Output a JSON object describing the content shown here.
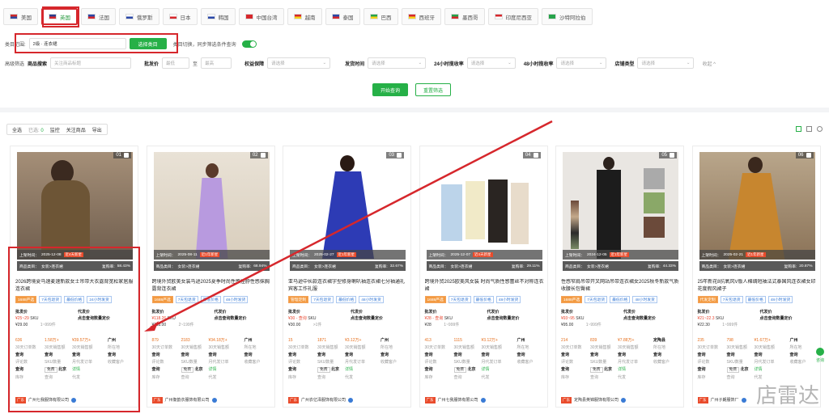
{
  "tabs": [
    {
      "label": "美国",
      "c1": "#cf2b2b",
      "c2": "#2f4aa0"
    },
    {
      "label": "英国",
      "c1": "#2c3f8f",
      "c2": "#d6272c"
    },
    {
      "label": "法国",
      "c1": "#2a48a8",
      "c2": "#d6272c"
    },
    {
      "label": "俄罗斯",
      "c1": "#ffffff",
      "c2": "#2a48a8"
    },
    {
      "label": "日本",
      "c1": "#ffffff",
      "c2": "#d6272c"
    },
    {
      "label": "韩国",
      "c1": "#ffffff",
      "c2": "#2a48a8"
    },
    {
      "label": "中国台湾",
      "c1": "#d6272c",
      "c2": "#d6272c"
    },
    {
      "label": "越南",
      "c1": "#d6272c",
      "c2": "#f6d21c"
    },
    {
      "label": "泰国",
      "c1": "#2a48a8",
      "c2": "#d6272c"
    },
    {
      "label": "巴西",
      "c1": "#26a34a",
      "c2": "#f6d21c"
    },
    {
      "label": "西班牙",
      "c1": "#d6272c",
      "c2": "#f6d21c"
    },
    {
      "label": "墨西哥",
      "c1": "#26a34a",
      "c2": "#d6272c"
    },
    {
      "label": "印度尼西亚",
      "c1": "#d6272c",
      "c2": "#ffffff"
    },
    {
      "label": "沙特阿拉伯",
      "c1": "#26a34a",
      "c2": "#26a34a"
    }
  ],
  "filters": {
    "cat_label": "类目范围:",
    "cat_value": "2级 · 连衣裙",
    "cat_btn": "选择类目",
    "sync_text": "类目切换，同步筛选条件查询",
    "adv_label": "高级筛选",
    "kw_label": "商品搜索",
    "kw_ph": "关注商品标题",
    "price_label": "批发价",
    "min_ph": "最低",
    "max_ph": "最高",
    "to": "至",
    "guar_label": "权益保障",
    "guar_ph": "请选择",
    "time_label": "发货时间",
    "time_ph": "请选择",
    "r24_label": "24小时揽收率",
    "r24_ph": "请选择",
    "r48_label": "48小时揽收率",
    "r48_ph": "请选择",
    "shop_label": "店铺类型",
    "shop_ph": "请选择",
    "collapse": "收起 ^",
    "search_btn": "开始查询",
    "reset_btn": "重置筛选"
  },
  "bulk": {
    "all": "全选",
    "selected": "已选:",
    "count": "0",
    "monitor": "监控",
    "follow": "关注商品",
    "export": "导出"
  },
  "col": {
    "onshelf": "上架时间：",
    "days": "上线天数:",
    "cat": "商品类目：",
    "cat_val": "女装>连衣裙",
    "repurchase": "复购率:",
    "wholesale": "批发价",
    "proxy": "代发价",
    "proxy_val": "点击查询数量定价",
    "sku": "SKU",
    "m30": "30天订单数",
    "s30": "30天销售额",
    "loc": "所在地",
    "eval": "评论数",
    "skun": "SKU数量",
    "agent": "月代发订单",
    "fav": "收藏客户",
    "query": "查询",
    "stock": "库存",
    "free": "免费",
    "proxy2": "代发",
    "detail": "详情",
    "gcc": "广东"
  },
  "cards": [
    {
      "n": "01",
      "title": "2026跨境夏马速麦速新款女士吊带大衣露背宽松家居服连衣裙",
      "date": "2025-12-08",
      "new": "近4天新星",
      "rep": "58.43%",
      "price_r": "¥25~29",
      "price": "¥29.00",
      "qty": "1~999件",
      "o30": "636",
      "s30": "1.58万+",
      "amt": "¥39.57万+",
      "loc": "广州",
      "c2": "北京",
      "shop": "广州七我服饰有限公司",
      "tags": [
        "1688严选",
        "7天包退货",
        "最低价格",
        "24小时发货"
      ],
      "img": "i1"
    },
    {
      "n": "02",
      "title": "跨境外贸欧美女装马逊2025夏季时尚性感挂脖性感抹胸露背连衣裙",
      "date": "2025-08-11",
      "new": "近1年新星",
      "rep": "68.94%",
      "price_r": "¥118.26",
      "price": "¥118.00",
      "qty": "2~199件",
      "o30": "879",
      "s30": "2183",
      "amt": "¥34.18万+",
      "loc": "广州",
      "c2": "北京",
      "shop": "广州衡韵衣服饰有限公司",
      "tags": [
        "1688严选",
        "7天包退货",
        "最低价格",
        "48小时发货"
      ],
      "img": "i2"
    },
    {
      "n": "03",
      "title": "亚马逊中长款连衣裙字型修身喇叭袖连衣裙七分袖通礼宾客工作礼服",
      "date": "2025-02-27",
      "new": "近1年新星",
      "rep": "32.67%",
      "price_r": "¥30 - 查询",
      "price": "¥30.00",
      "qty": ">1件",
      "o30": "15",
      "s30": "1871",
      "amt": "¥3.12万+",
      "loc": "广州",
      "c2": "北京",
      "shop": "广州衣亿泽服饰有限公司",
      "tags": [
        "管理定制",
        "7天包退货",
        "最低价格",
        "48小时发货"
      ],
      "img": "i3"
    },
    {
      "n": "04",
      "title": "跨境外贸2025欧美风女装 时尚气质性感蕾丝不对称连衣裙",
      "date": "2025-12-07",
      "new": "近4天新星",
      "rep": "29.11%",
      "price_r": "¥28 - 查询",
      "price": "¥28",
      "qty": "1~999件",
      "o30": "413",
      "s30": "1115",
      "amt": "¥3.12万+",
      "loc": "广州",
      "c2": "北京",
      "shop": "广州七我服饰有限公司",
      "tags": [
        "1688严选",
        "7天包退货",
        "最低价格",
        "48小时发货"
      ],
      "img": "i4"
    },
    {
      "n": "05",
      "title": "性感窄肩吊带开叉网站吊带连衣裙女2025秋冬新款气质收腰长包臀裙",
      "date": "2024-12-05",
      "new": "近1年新星",
      "rep": "44.33%",
      "price_r": "¥93~95",
      "price": "¥95.00",
      "qty": "1~999件",
      "o30": "214",
      "s30": "839",
      "amt": "¥7.88万+",
      "loc": "定陶县",
      "c2": "北京",
      "shop": "定陶县英锦服饰有限公司",
      "tags": [
        "1688严选",
        "7天包退货",
        "最低价格",
        "48小时发货"
      ],
      "img": "i5"
    },
    {
      "n": "06",
      "title": "25年新花8抗氧风V版人棉绸短袖法式泰国风连衣裙女印花度假风裙子",
      "date": "2025-02-21",
      "new": "近1年新星",
      "rep": "20.87%",
      "price_r": "¥21~22.3",
      "price": "¥22.30",
      "qty": "1~999件",
      "o30": "235",
      "s30": "798",
      "amt": "¥1.67万+",
      "loc": "广州",
      "c2": "北京",
      "shop": "广州子朗服饰厂",
      "tags": [
        "代发定制",
        "7天包退货",
        "最低价格",
        "48小时发货"
      ],
      "img": "i6"
    }
  ],
  "watermark": "店雷达",
  "side": "咨询"
}
